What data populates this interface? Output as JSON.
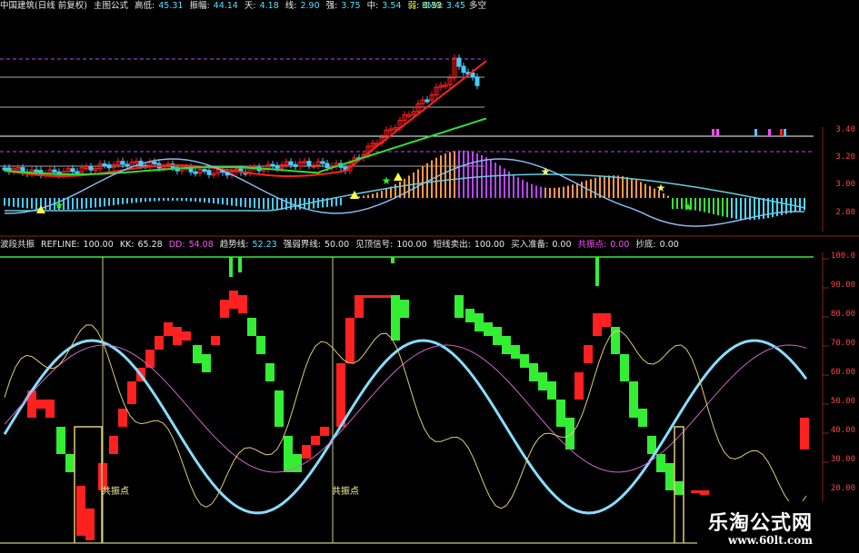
{
  "top_header": {
    "stock": "中国建筑(日线 前复权)",
    "formula": "主图公式",
    "high_label": "高低:",
    "high_value": "45.31",
    "amp_label": "振幅:",
    "amp_value": "44.14",
    "day_label": "天:",
    "day_value": "4.18",
    "line_label": "线:",
    "line_value": "2.90",
    "strong_label": "强:",
    "strong_value": "3.75",
    "mid_label": "中:",
    "mid_value": "3.54",
    "weak_label": "弱:",
    "weak_value": "3.33",
    "kma_label": "KMA:",
    "kma_value": "3.45",
    "kma_state": "多空"
  },
  "top_axis": [
    "3.40",
    "3.20",
    "3.00",
    "2.80"
  ],
  "bottom_header": {
    "name": "波段共振",
    "refline_label": "REFLINE:",
    "refline_value": "100.00",
    "kk_label": "KK:",
    "kk_value": "65.28",
    "dd_label": "DD:",
    "dd_value": "54.08",
    "trend_label": "趋势线:",
    "trend_value": "52.23",
    "boundary_label": "强弱界线:",
    "boundary_value": "50.00",
    "top_label": "见顶信号:",
    "top_value": "100.00",
    "short_label": "短线卖出:",
    "short_value": "100.00",
    "buy_label": "买入准备:",
    "buy_value": "0.00",
    "reso_label": "共振点:",
    "reso_value": "0.00",
    "bottom_label": "抄底:",
    "bottom_value": "0.00"
  },
  "bottom_axis": [
    "100.0",
    "90.00",
    "80.00",
    "70.00",
    "60.00",
    "50.00",
    "40.00",
    "30.00",
    "20.00"
  ],
  "captions": {
    "resonance_1": "共振点",
    "resonance_2": "共振点"
  },
  "watermark": {
    "title": "乐淘公式网",
    "url": "www.60lt.com"
  },
  "colors": {
    "background": "#000000",
    "up": "#ff2020",
    "down": "#33ee33",
    "axis": "#ff4444"
  }
}
